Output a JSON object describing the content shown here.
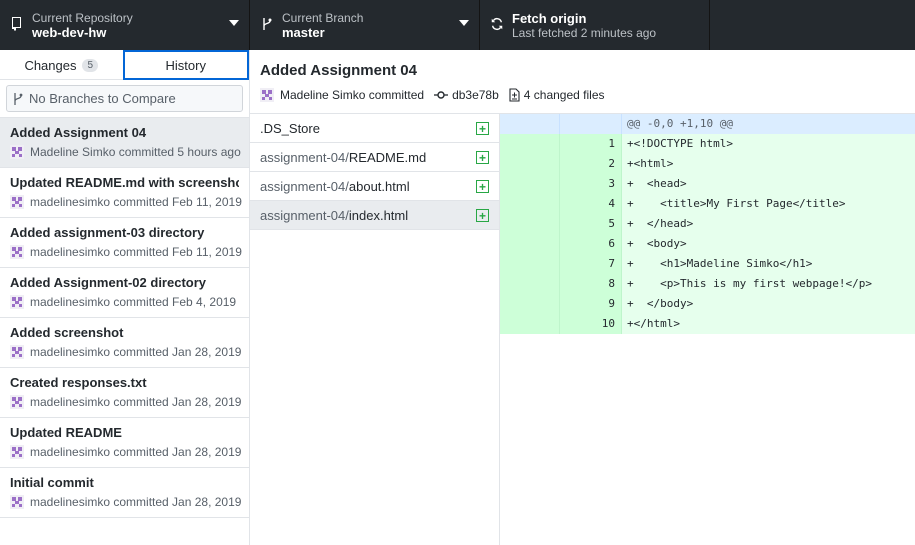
{
  "toolbar": {
    "repo": {
      "label": "Current Repository",
      "value": "web-dev-hw"
    },
    "branch": {
      "label": "Current Branch",
      "value": "master"
    },
    "fetch": {
      "label": "Fetch origin",
      "value": "Last fetched 2 minutes ago"
    }
  },
  "sidebar": {
    "tabs": [
      {
        "label": "Changes",
        "count": "5"
      },
      {
        "label": "History"
      }
    ],
    "compare_placeholder": "No Branches to Compare",
    "commits": [
      {
        "title": "Added Assignment 04",
        "meta": "Madeline Simko committed 5 hours ago"
      },
      {
        "title": "Updated README.md with screenshot",
        "meta": "madelinesimko committed Feb 11, 2019"
      },
      {
        "title": "Added assignment-03 directory",
        "meta": "madelinesimko committed Feb 11, 2019"
      },
      {
        "title": "Added Assignment-02 directory",
        "meta": "madelinesimko committed Feb 4, 2019"
      },
      {
        "title": "Added screenshot",
        "meta": "madelinesimko committed Jan 28, 2019"
      },
      {
        "title": "Created responses.txt",
        "meta": "madelinesimko committed Jan 28, 2019"
      },
      {
        "title": "Updated README",
        "meta": "madelinesimko committed Jan 28, 2019"
      },
      {
        "title": "Initial commit",
        "meta": "madelinesimko committed Jan 28, 2019"
      }
    ]
  },
  "commit": {
    "title": "Added Assignment 04",
    "author": "Madeline Simko committed",
    "sha": "db3e78b",
    "changed": "4 changed files"
  },
  "files": [
    {
      "dir": "",
      "name": ".DS_Store"
    },
    {
      "dir": "assignment-04/",
      "name": "README.md"
    },
    {
      "dir": "assignment-04/",
      "name": "about.html"
    },
    {
      "dir": "assignment-04/",
      "name": "index.html"
    }
  ],
  "diff": {
    "hunk": "@@ -0,0 +1,10 @@",
    "lines": [
      {
        "n": "1",
        "code": "+<!DOCTYPE html>"
      },
      {
        "n": "2",
        "code": "+<html>"
      },
      {
        "n": "3",
        "code": "+  <head>"
      },
      {
        "n": "4",
        "code": "+    <title>My First Page</title>"
      },
      {
        "n": "5",
        "code": "+  </head>"
      },
      {
        "n": "6",
        "code": "+  <body>"
      },
      {
        "n": "7",
        "code": "+    <h1>Madeline Simko</h1>"
      },
      {
        "n": "8",
        "code": "+    <p>This is my first webpage!</p>"
      },
      {
        "n": "9",
        "code": "+  </body>"
      },
      {
        "n": "10",
        "code": "+</html>"
      }
    ]
  },
  "colors": {
    "toolbar_bg": "#24292e",
    "accent": "#0366d6",
    "added_bg": "#e6ffed",
    "added_gutter": "#cdffd8",
    "add_icon": "#28a745"
  }
}
